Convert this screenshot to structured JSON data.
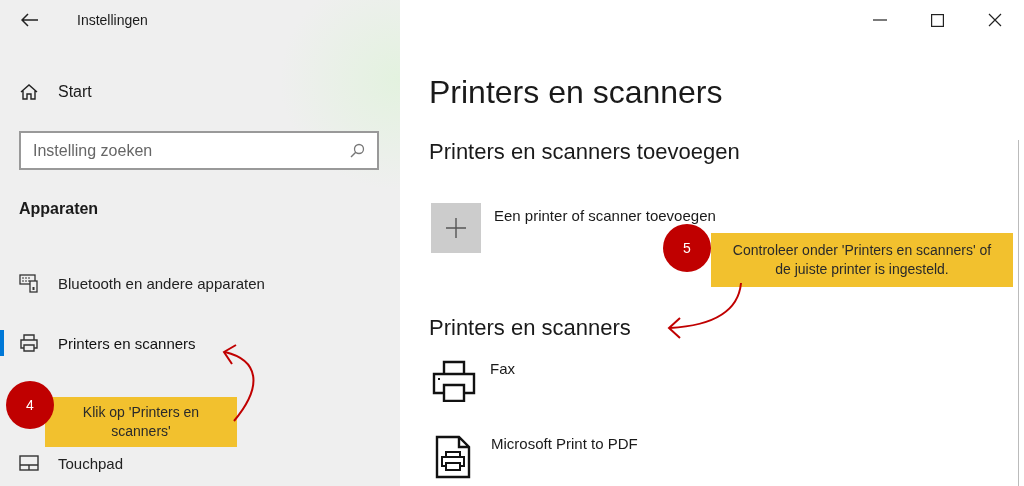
{
  "window": {
    "title": "Instellingen"
  },
  "sidebar": {
    "home": {
      "label": "Start"
    },
    "search": {
      "placeholder": "Instelling zoeken"
    },
    "section": "Apparaten",
    "items": [
      {
        "label": "Bluetooth en andere apparaten",
        "kind": "bluetooth",
        "selected": false
      },
      {
        "label": "Printers en scanners",
        "kind": "printer",
        "selected": true
      },
      {
        "label": "Touchpad",
        "kind": "touchpad",
        "selected": false
      }
    ]
  },
  "page": {
    "title": "Printers en scanners",
    "add_section": {
      "heading": "Printers en scanners toevoegen",
      "button": "Een printer of scanner toevoegen"
    },
    "list_section": {
      "heading": "Printers en scanners",
      "devices": [
        {
          "name": "Fax",
          "kind": "fax"
        },
        {
          "name": "Microsoft Print to PDF",
          "kind": "pdf"
        }
      ]
    }
  },
  "annotations": [
    {
      "number": "4",
      "text": "Klik op 'Printers en scanners'"
    },
    {
      "number": "5",
      "text": "Controleer onder 'Printers en scanners' of de juiste printer is ingesteld."
    }
  ]
}
